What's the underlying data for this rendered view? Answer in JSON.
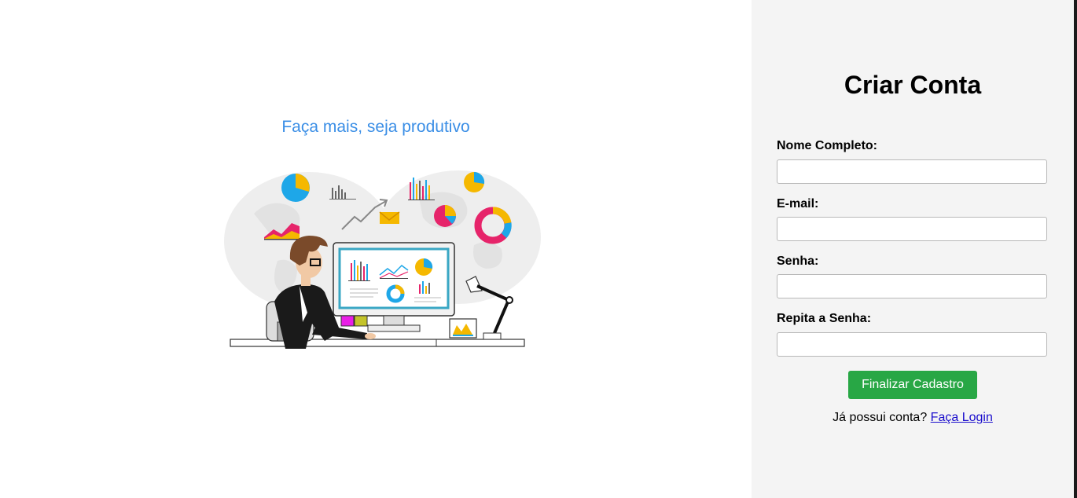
{
  "hero": {
    "tagline": "Faça mais, seja produtivo",
    "illustration": "person-at-computer-analytics-illustration"
  },
  "form": {
    "title": "Criar Conta",
    "fields": [
      {
        "label": "Nome Completo:",
        "value": "",
        "placeholder": ""
      },
      {
        "label": "E-mail:",
        "value": "",
        "placeholder": ""
      },
      {
        "label": "Senha:",
        "value": "",
        "placeholder": ""
      },
      {
        "label": "Repita a Senha:",
        "value": "",
        "placeholder": ""
      }
    ],
    "submit_label": "Finalizar Cadastro",
    "login_prompt": "Já possui conta?",
    "login_link": "Faça Login"
  },
  "colors": {
    "tagline": "#3a8ee6",
    "panel_bg": "#f4f4f4",
    "submit_bg": "#28a745",
    "link": "#1a0dcc"
  }
}
